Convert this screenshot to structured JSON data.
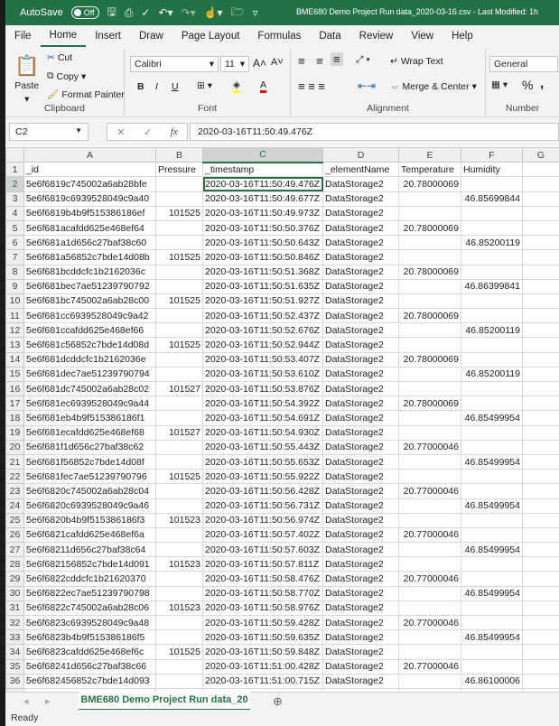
{
  "titlebar": {
    "autosave_label": "AutoSave",
    "autosave_state": "Off",
    "title": "BME680 Demo Project Run data_2020-03-16.csv  -  Last Modified: 1h"
  },
  "menu_tabs": [
    "File",
    "Home",
    "Insert",
    "Draw",
    "Page Layout",
    "Formulas",
    "Data",
    "Review",
    "View",
    "Help"
  ],
  "active_tab": "Home",
  "ribbon": {
    "clipboard": {
      "label": "Clipboard",
      "paste": "Paste",
      "cut": "Cut",
      "copy": "Copy",
      "format_painter": "Format Painter"
    },
    "font": {
      "label": "Font",
      "font_name": "Calibri",
      "font_size": "11",
      "bold": "B",
      "italic": "I",
      "underline": "U",
      "colors": {
        "highlight": "#ffff00",
        "font": "#ff0000"
      }
    },
    "alignment": {
      "label": "Alignment",
      "wrap_text": "Wrap Text",
      "merge_center": "Merge & Center"
    },
    "number": {
      "label": "Number",
      "format": "General",
      "percent": "%",
      "comma": ","
    }
  },
  "formula_bar": {
    "name_box": "C2",
    "fx": "fx",
    "value": "2020-03-16T11:50:49.476Z"
  },
  "sheet": {
    "columns": [
      "A",
      "B",
      "C",
      "D",
      "E",
      "F",
      "G"
    ],
    "selected_column": "C",
    "headers": [
      "_id",
      "Pressure",
      "_timestamp",
      "_elementName",
      "Temperature",
      "Humidity",
      ""
    ],
    "rows": [
      [
        "5e6f6819c745002a6ab28bfe",
        "",
        "2020-03-16T11:50:49.476Z",
        "DataStorage2",
        "20.78000069",
        ""
      ],
      [
        "5e6f6819c6939528049c9a40",
        "",
        "2020-03-16T11:50:49.677Z",
        "DataStorage2",
        "",
        "46.85699844"
      ],
      [
        "5e6f6819b4b9f515386186ef",
        "101525",
        "2020-03-16T11:50:49.973Z",
        "DataStorage2",
        "",
        ""
      ],
      [
        "5e6f681acafdd625e468ef64",
        "",
        "2020-03-16T11:50:50.376Z",
        "DataStorage2",
        "20.78000069",
        ""
      ],
      [
        "5e6f681a1d656c27baf38c60",
        "",
        "2020-03-16T11:50:50.643Z",
        "DataStorage2",
        "",
        "46.85200119"
      ],
      [
        "5e6f681a56852c7bde14d08b",
        "101525",
        "2020-03-16T11:50:50.846Z",
        "DataStorage2",
        "",
        ""
      ],
      [
        "5e6f681bcddcfc1b2162036c",
        "",
        "2020-03-16T11:50:51.368Z",
        "DataStorage2",
        "20.78000069",
        ""
      ],
      [
        "5e6f681bec7ae51239790792",
        "",
        "2020-03-16T11:50:51.635Z",
        "DataStorage2",
        "",
        "46.86399841"
      ],
      [
        "5e6f681bc745002a6ab28c00",
        "101525",
        "2020-03-16T11:50:51.927Z",
        "DataStorage2",
        "",
        ""
      ],
      [
        "5e6f681cc6939528049c9a42",
        "",
        "2020-03-16T11:50:52.437Z",
        "DataStorage2",
        "20.78000069",
        ""
      ],
      [
        "5e6f681ccafdd625e468ef66",
        "",
        "2020-03-16T11:50:52.676Z",
        "DataStorage2",
        "",
        "46.85200119"
      ],
      [
        "5e6f681c56852c7bde14d08d",
        "101525",
        "2020-03-16T11:50:52.944Z",
        "DataStorage2",
        "",
        ""
      ],
      [
        "5e6f681dcddcfc1b2162036e",
        "",
        "2020-03-16T11:50:53.407Z",
        "DataStorage2",
        "20.78000069",
        ""
      ],
      [
        "5e6f681dec7ae51239790794",
        "",
        "2020-03-16T11:50:53.610Z",
        "DataStorage2",
        "",
        "46.85200119"
      ],
      [
        "5e6f681dc745002a6ab28c02",
        "101527",
        "2020-03-16T11:50:53.876Z",
        "DataStorage2",
        "",
        ""
      ],
      [
        "5e6f681ec6939528049c9a44",
        "",
        "2020-03-16T11:50:54.392Z",
        "DataStorage2",
        "20.78000069",
        ""
      ],
      [
        "5e6f681eb4b9f515386186f1",
        "",
        "2020-03-16T11:50:54.691Z",
        "DataStorage2",
        "",
        "46.85499954"
      ],
      [
        "5e6f681ecafdd625e468ef68",
        "101527",
        "2020-03-16T11:50:54.930Z",
        "DataStorage2",
        "",
        ""
      ],
      [
        "5e6f681f1d656c27baf38c62",
        "",
        "2020-03-16T11:50:55.443Z",
        "DataStorage2",
        "20.77000046",
        ""
      ],
      [
        "5e6f681f56852c7bde14d08f",
        "",
        "2020-03-16T11:50:55.653Z",
        "DataStorage2",
        "",
        "46.85499954"
      ],
      [
        "5e6f681fec7ae51239790796",
        "101525",
        "2020-03-16T11:50:55.922Z",
        "DataStorage2",
        "",
        ""
      ],
      [
        "5e6f6820c745002a6ab28c04",
        "",
        "2020-03-16T11:50:56.428Z",
        "DataStorage2",
        "20.77000046",
        ""
      ],
      [
        "5e6f6820c6939528049c9a46",
        "",
        "2020-03-16T11:50:56.731Z",
        "DataStorage2",
        "",
        "46.85499954"
      ],
      [
        "5e6f6820b4b9f515386186f3",
        "101523",
        "2020-03-16T11:50:56.974Z",
        "DataStorage2",
        "",
        ""
      ],
      [
        "5e6f6821cafdd625e468ef6a",
        "",
        "2020-03-16T11:50:57.402Z",
        "DataStorage2",
        "20.77000046",
        ""
      ],
      [
        "5e6f68211d656c27baf38c64",
        "",
        "2020-03-16T11:50:57.603Z",
        "DataStorage2",
        "",
        "46.85499954"
      ],
      [
        "5e6f682156852c7bde14d091",
        "101523",
        "2020-03-16T11:50:57.811Z",
        "DataStorage2",
        "",
        ""
      ],
      [
        "5e6f6822cddcfc1b21620370",
        "",
        "2020-03-16T11:50:58.476Z",
        "DataStorage2",
        "20.77000046",
        ""
      ],
      [
        "5e6f6822ec7ae51239790798",
        "",
        "2020-03-16T11:50:58.770Z",
        "DataStorage2",
        "",
        "46.85499954"
      ],
      [
        "5e6f6822c745002a6ab28c06",
        "101523",
        "2020-03-16T11:50:58.976Z",
        "DataStorage2",
        "",
        ""
      ],
      [
        "5e6f6823c6939528049c9a48",
        "",
        "2020-03-16T11:50:59.428Z",
        "DataStorage2",
        "20.77000046",
        ""
      ],
      [
        "5e6f6823b4b9f515386186f5",
        "",
        "2020-03-16T11:50:59.635Z",
        "DataStorage2",
        "",
        "46.85499954"
      ],
      [
        "5e6f6823cafdd625e468ef6c",
        "101525",
        "2020-03-16T11:50:59.848Z",
        "DataStorage2",
        "",
        ""
      ],
      [
        "5e6f68241d656c27baf38c66",
        "",
        "2020-03-16T11:51:00.428Z",
        "DataStorage2",
        "20.77000046",
        ""
      ],
      [
        "5e6f682456852c7bde14d093",
        "",
        "2020-03-16T11:51:00.715Z",
        "DataStorage2",
        "",
        "46.86100006"
      ],
      [
        "5e6f6824cddcfc1b21620373",
        "101527",
        "2020-03-16T11:51:00.934Z",
        "DataStorage2",
        "",
        ""
      ]
    ]
  },
  "sheet_tab": "BME680 Demo Project Run data_20",
  "status": "Ready",
  "colors": {
    "accent": "#217346"
  }
}
